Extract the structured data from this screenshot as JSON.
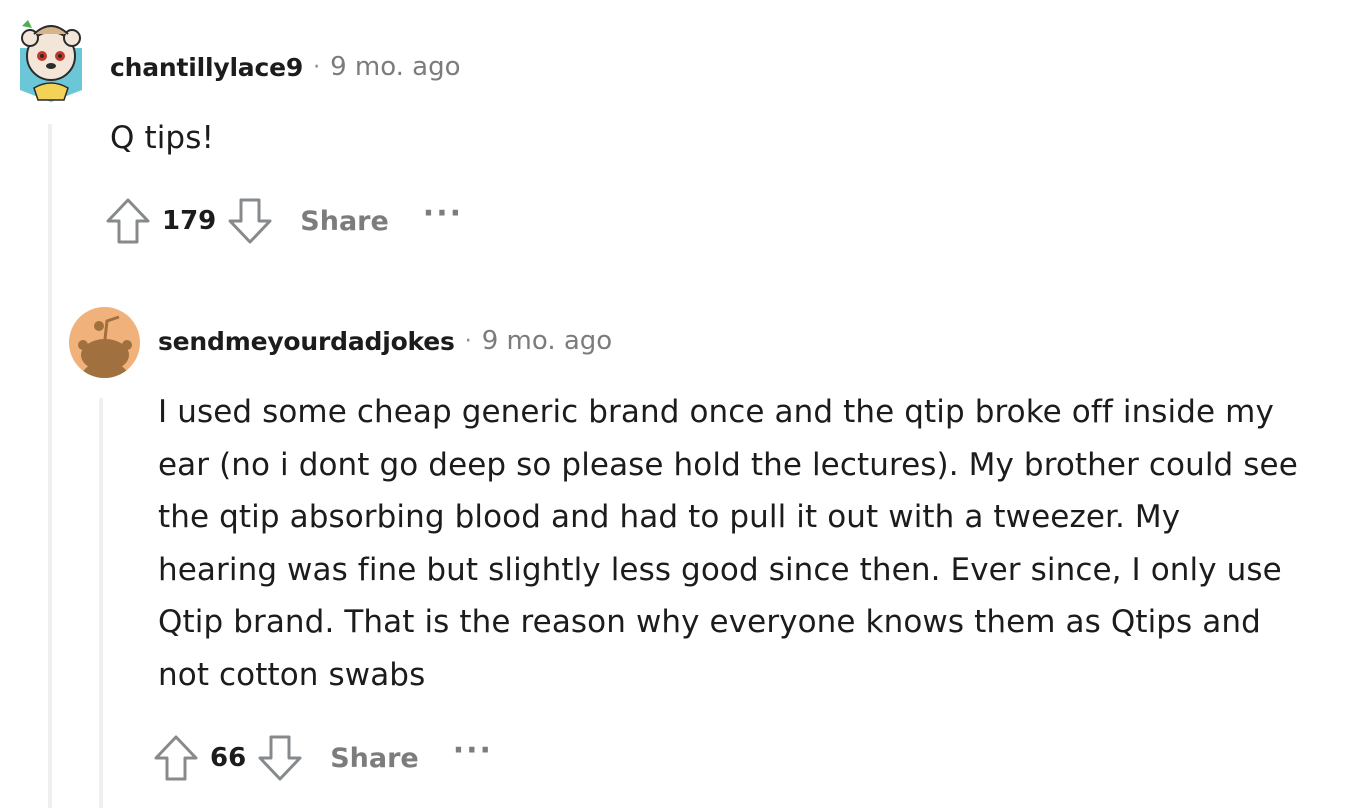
{
  "comments": [
    {
      "username": "chantillylace9",
      "separator": "·",
      "time": "9 mo. ago",
      "body": "Q tips!",
      "score": "179",
      "share_label": "Share",
      "more_label": "···"
    },
    {
      "username": "sendmeyourdadjokes",
      "separator": "·",
      "time": "9 mo. ago",
      "body_lines": [
        "I used some cheap generic brand once and the qtip broke off inside my",
        "ear (no i dont go deep so please hold the lectures). My brother could see",
        "the qtip absorbing blood and had to pull it out with a tweezer. My",
        "hearing was fine but slightly less good since then. Ever since, I only use",
        "Qtip brand. That is the reason why everyone knows them as Qtips and",
        "not cotton swabs"
      ],
      "score": "66",
      "share_label": "Share",
      "more_label": "···"
    }
  ],
  "colors": {
    "text": "#1c1c1c",
    "meta": "#7c7c7c",
    "thread_line": "#edeff1",
    "avatar2_bg": "#f0b27a"
  },
  "icons": [
    "snoo-avatar-icon",
    "upvote-icon",
    "downvote-icon",
    "more-options-icon"
  ]
}
